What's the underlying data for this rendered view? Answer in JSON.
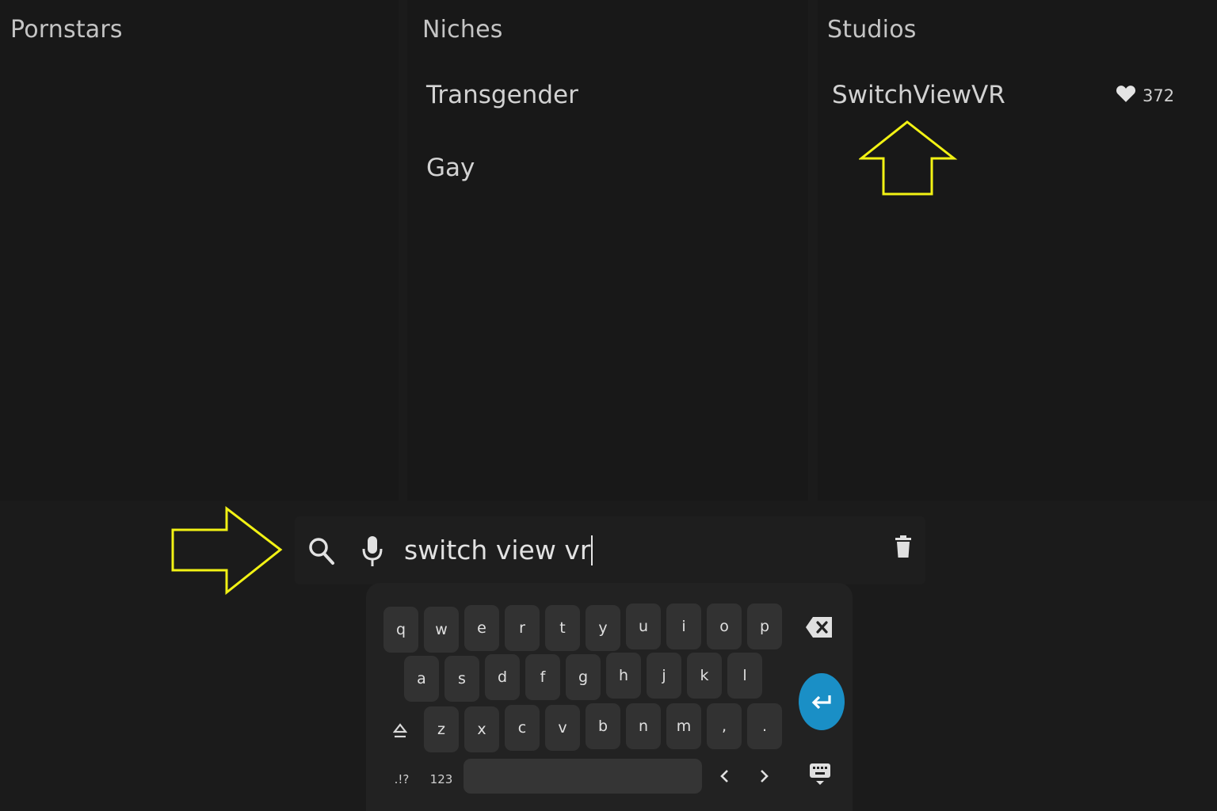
{
  "columns": {
    "pornstars": {
      "title": "Pornstars"
    },
    "niches": {
      "title": "Niches",
      "items": [
        "Transgender",
        "Gay"
      ]
    },
    "studios": {
      "title": "Studios",
      "items": [
        {
          "name": "SwitchViewVR",
          "likes": "372"
        }
      ]
    }
  },
  "search": {
    "value": "switch view vr"
  },
  "keyboard": {
    "row1": [
      "q",
      "w",
      "e",
      "r",
      "t",
      "y",
      "u",
      "i",
      "o",
      "p"
    ],
    "row2": [
      "a",
      "s",
      "d",
      "f",
      "g",
      "h",
      "j",
      "k",
      "l"
    ],
    "row3": [
      "z",
      "x",
      "c",
      "v",
      "b",
      "n",
      "m",
      ",",
      "."
    ],
    "symbols_label": ".!?",
    "numbers_label": "123"
  },
  "colors": {
    "accent_enter": "#1a8fc6",
    "annotation_arrow": "#f2f214"
  },
  "icons": [
    "search-icon",
    "mic-icon",
    "trash-icon",
    "heart-icon",
    "backspace-icon",
    "enter-icon",
    "shift-icon",
    "cursor-left-icon",
    "cursor-right-icon",
    "hide-keyboard-icon",
    "annotation-arrow"
  ]
}
